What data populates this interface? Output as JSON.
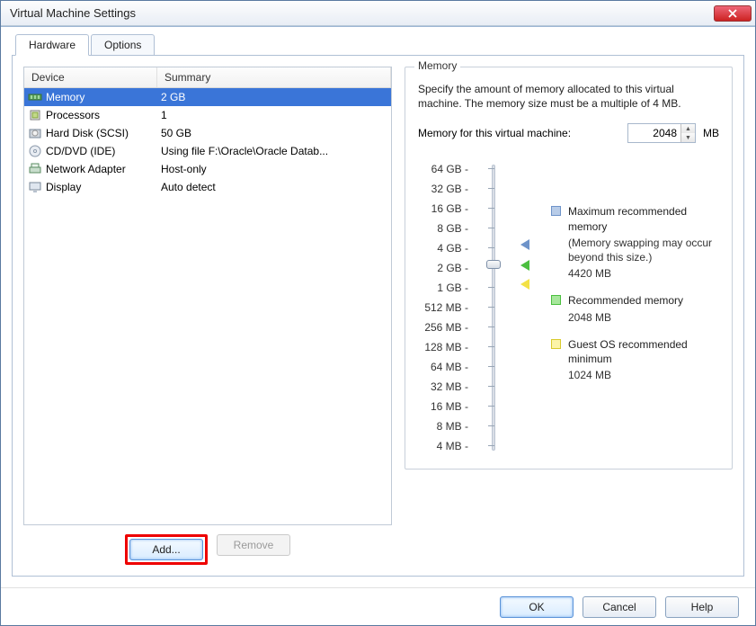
{
  "window_title": "Virtual Machine Settings",
  "tabs": {
    "hardware": "Hardware",
    "options": "Options"
  },
  "columns": {
    "device": "Device",
    "summary": "Summary"
  },
  "devices": [
    {
      "name": "Memory",
      "summary": "2 GB",
      "icon": "memory",
      "selected": true
    },
    {
      "name": "Processors",
      "summary": "1",
      "icon": "cpu"
    },
    {
      "name": "Hard Disk (SCSI)",
      "summary": "50 GB",
      "icon": "hdd"
    },
    {
      "name": "CD/DVD (IDE)",
      "summary": "Using file F:\\Oracle\\Oracle Datab...",
      "icon": "cd"
    },
    {
      "name": "Network Adapter",
      "summary": "Host-only",
      "icon": "net"
    },
    {
      "name": "Display",
      "summary": "Auto detect",
      "icon": "display"
    }
  ],
  "buttons": {
    "add": "Add...",
    "remove": "Remove",
    "ok": "OK",
    "cancel": "Cancel",
    "help": "Help"
  },
  "memory": {
    "group_title": "Memory",
    "description": "Specify the amount of memory allocated to this virtual machine. The memory size must be a multiple of 4 MB.",
    "field_label": "Memory for this virtual machine:",
    "value": "2048",
    "unit": "MB",
    "ticks": [
      "64 GB",
      "32 GB",
      "16 GB",
      "8 GB",
      "4 GB",
      "2 GB",
      "1 GB",
      "512 MB",
      "256 MB",
      "128 MB",
      "64 MB",
      "32 MB",
      "16 MB",
      "8 MB",
      "4 MB"
    ],
    "legend": {
      "max": {
        "title": "Maximum recommended memory",
        "sub1": "(Memory swapping may occur beyond this size.)",
        "sub2": "4420 MB",
        "color": "#6e93c9"
      },
      "rec": {
        "title": "Recommended memory",
        "sub": "2048 MB",
        "color": "#4bbf3f"
      },
      "min": {
        "title": "Guest OS recommended minimum",
        "sub": "1024 MB",
        "color": "#f3e145"
      }
    }
  }
}
